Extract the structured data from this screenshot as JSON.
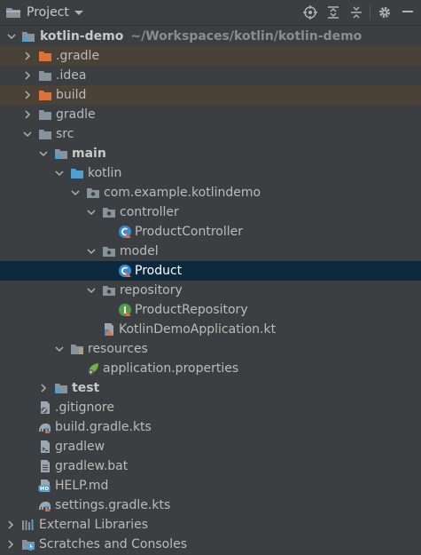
{
  "header": {
    "title": "Project"
  },
  "tree": {
    "root": {
      "name": "kotlin-demo",
      "path": "~/Workspaces/kotlin/kotlin-demo"
    },
    "gradle_dot": ".gradle",
    "idea": ".idea",
    "build": "build",
    "gradle": "gradle",
    "src": "src",
    "main": "main",
    "kotlin": "kotlin",
    "package": "com.example.kotlindemo",
    "controller": "controller",
    "product_controller": "ProductController",
    "model": "model",
    "product": "Product",
    "repository": "repository",
    "product_repository": "ProductRepository",
    "app_file": "KotlinDemoApplication.kt",
    "resources": "resources",
    "app_properties": "application.properties",
    "test": "test",
    "gitignore": ".gitignore",
    "build_gradle": "build.gradle.kts",
    "gradlew": "gradlew",
    "gradlew_bat": "gradlew.bat",
    "help": "HELP.md",
    "settings_gradle": "settings.gradle.kts"
  },
  "external_libraries": "External Libraries",
  "scratches": "Scratches and Consoles",
  "colors": {
    "background": "#3c3f41",
    "selected_row": "#0d293e",
    "excluded_row": "#4a4137",
    "folder": "#87939a",
    "excluded_folder": "#d9743b",
    "source_folder": "#4f9fcf",
    "kotlin_class": "#3a8bd6"
  }
}
